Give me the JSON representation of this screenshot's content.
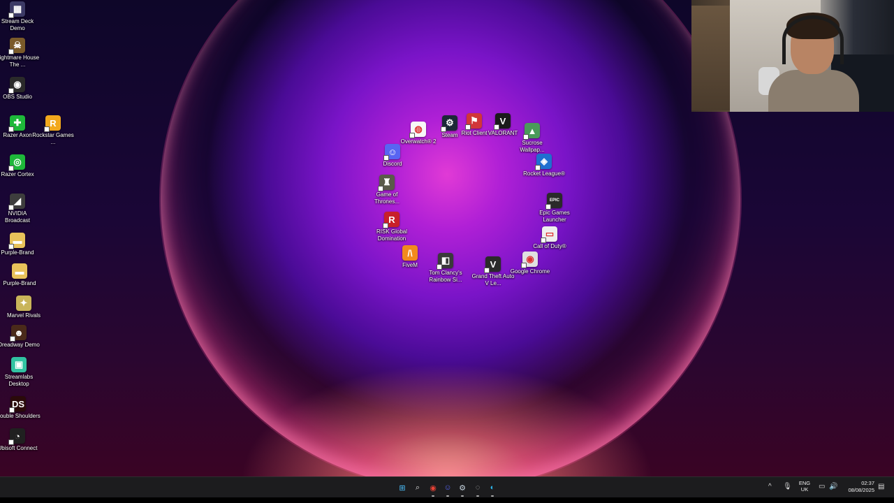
{
  "desktop_icons_left": [
    {
      "label": "Stream Deck Demo",
      "glyph": "▦",
      "color": "#3c3a66",
      "icon": "stream-deck-icon",
      "shortcut": true
    },
    {
      "label": "Nightmare House The ...",
      "glyph": "☠",
      "color": "#7a5a2a",
      "icon": "nightmare-house-icon",
      "shortcut": true
    },
    {
      "label": "OBS Studio",
      "glyph": "◉",
      "color": "#2a2a2a",
      "icon": "obs-studio-icon",
      "shortcut": true
    },
    {
      "label": "Razer Axon",
      "glyph": "✚",
      "color": "#1eb83a",
      "icon": "razer-axon-icon",
      "shortcut": true
    },
    {
      "label": "Razer Cortex",
      "glyph": "◎",
      "color": "#1eb83a",
      "icon": "razer-cortex-icon",
      "shortcut": true
    },
    {
      "label": "NVIDIA Broadcast",
      "glyph": "◢",
      "color": "#3d3d3d",
      "icon": "nvidia-broadcast-icon",
      "shortcut": true
    },
    {
      "label": "Purple-Brand",
      "glyph": "▬",
      "color": "#e8c25a",
      "icon": "folder-icon",
      "shortcut": true
    },
    {
      "label": "Purple-Brand",
      "glyph": "▬",
      "color": "#e8c25a",
      "icon": "folder-icon",
      "shortcut": false
    },
    {
      "label": "Marvel Rivals",
      "glyph": "✦",
      "color": "#c9b55a",
      "icon": "marvel-rivals-icon",
      "shortcut": false
    },
    {
      "label": "Dreadway Demo",
      "glyph": "☻",
      "color": "#4a2a1a",
      "icon": "dreadway-icon",
      "shortcut": true
    },
    {
      "label": "Streamlabs Desktop",
      "glyph": "▣",
      "color": "#31c3a2",
      "icon": "streamlabs-icon",
      "shortcut": false
    },
    {
      "label": "Double Shoulders",
      "glyph": "DS",
      "color": "#2a0a0a",
      "icon": "double-shoulders-icon",
      "shortcut": true
    },
    {
      "label": "Ubisoft Connect",
      "glyph": "◔",
      "color": "#202020",
      "icon": "ubisoft-connect-icon",
      "shortcut": true
    },
    {
      "label": "Rockstar Games ...",
      "glyph": "R",
      "color": "#f2a81d",
      "icon": "rockstar-games-icon",
      "shortcut": true
    }
  ],
  "desktop_icons_circle": [
    {
      "label": "Overwatch® 2",
      "glyph": "◍",
      "color": "#f7f7f7",
      "icon": "overwatch-icon",
      "shortcut": true
    },
    {
      "label": "Steam",
      "glyph": "⚙",
      "color": "#1b2838",
      "icon": "steam-icon",
      "shortcut": true
    },
    {
      "label": "Riot Client",
      "glyph": "⚑",
      "color": "#d13639",
      "icon": "riot-client-icon",
      "shortcut": true
    },
    {
      "label": "VALORANT",
      "glyph": "V",
      "color": "#1a1a1a",
      "icon": "valorant-icon",
      "shortcut": true
    },
    {
      "label": "Sucrose Wallpap...",
      "glyph": "▲",
      "color": "#4a9a5a",
      "icon": "sucrose-wallpaper-icon",
      "shortcut": true
    },
    {
      "label": "Discord",
      "glyph": "☺",
      "color": "#5865f2",
      "icon": "discord-icon",
      "shortcut": true
    },
    {
      "label": "Rocket League®",
      "glyph": "◈",
      "color": "#1f6fd0",
      "icon": "rocket-league-icon",
      "shortcut": true
    },
    {
      "label": "Game of Thrones...",
      "glyph": "♜",
      "color": "#5a5a4a",
      "icon": "game-of-thrones-icon",
      "shortcut": true
    },
    {
      "label": "Epic Games Launcher",
      "glyph": "EPIC",
      "color": "#2a2a2a",
      "icon": "epic-games-icon",
      "shortcut": true
    },
    {
      "label": "RISK Global Domination",
      "glyph": "R",
      "color": "#c8202a",
      "icon": "risk-icon",
      "shortcut": true
    },
    {
      "label": "Call of Duty®",
      "glyph": "▭",
      "color": "#eeeeee",
      "icon": "call-of-duty-icon",
      "shortcut": true
    },
    {
      "label": "FiveM",
      "glyph": "/\\",
      "color": "#f28a1e",
      "icon": "fivem-icon",
      "shortcut": false
    },
    {
      "label": "Tom Clancy's Rainbow Si...",
      "glyph": "◧",
      "color": "#3a3a3a",
      "icon": "rainbow-six-icon",
      "shortcut": true
    },
    {
      "label": "Grand Theft Auto V Le...",
      "glyph": "V",
      "color": "#2a2a2a",
      "icon": "gta-v-icon",
      "shortcut": true
    },
    {
      "label": "Google Chrome",
      "glyph": "◉",
      "color": "#e0e0e0",
      "icon": "chrome-icon",
      "shortcut": true
    }
  ],
  "taskbar": {
    "apps": [
      {
        "name": "start-button",
        "glyph": "⊞",
        "color": "#4cc2ff",
        "dot": false
      },
      {
        "name": "search-button",
        "glyph": "⌕",
        "color": "#dddddd",
        "dot": false
      },
      {
        "name": "taskbar-chrome",
        "glyph": "◉",
        "color": "#e94235",
        "dot": true
      },
      {
        "name": "taskbar-discord",
        "glyph": "☺",
        "color": "#5865f2",
        "dot": true
      },
      {
        "name": "taskbar-steam",
        "glyph": "⚙",
        "color": "#c7d5e0",
        "dot": true
      },
      {
        "name": "taskbar-obs",
        "glyph": "◌",
        "color": "#bbbbbb",
        "dot": true
      },
      {
        "name": "taskbar-edge",
        "glyph": "◐",
        "color": "#2bb3e8",
        "dot": true
      }
    ],
    "tray_chevron": "^",
    "mic_glyph": "🎙",
    "network_glyph": "▭",
    "volume_glyph": "🔊",
    "lang_line1": "ENG",
    "lang_line2": "UK",
    "time": "02:37",
    "date": "08/08/2025",
    "notification_glyph": "▤"
  }
}
